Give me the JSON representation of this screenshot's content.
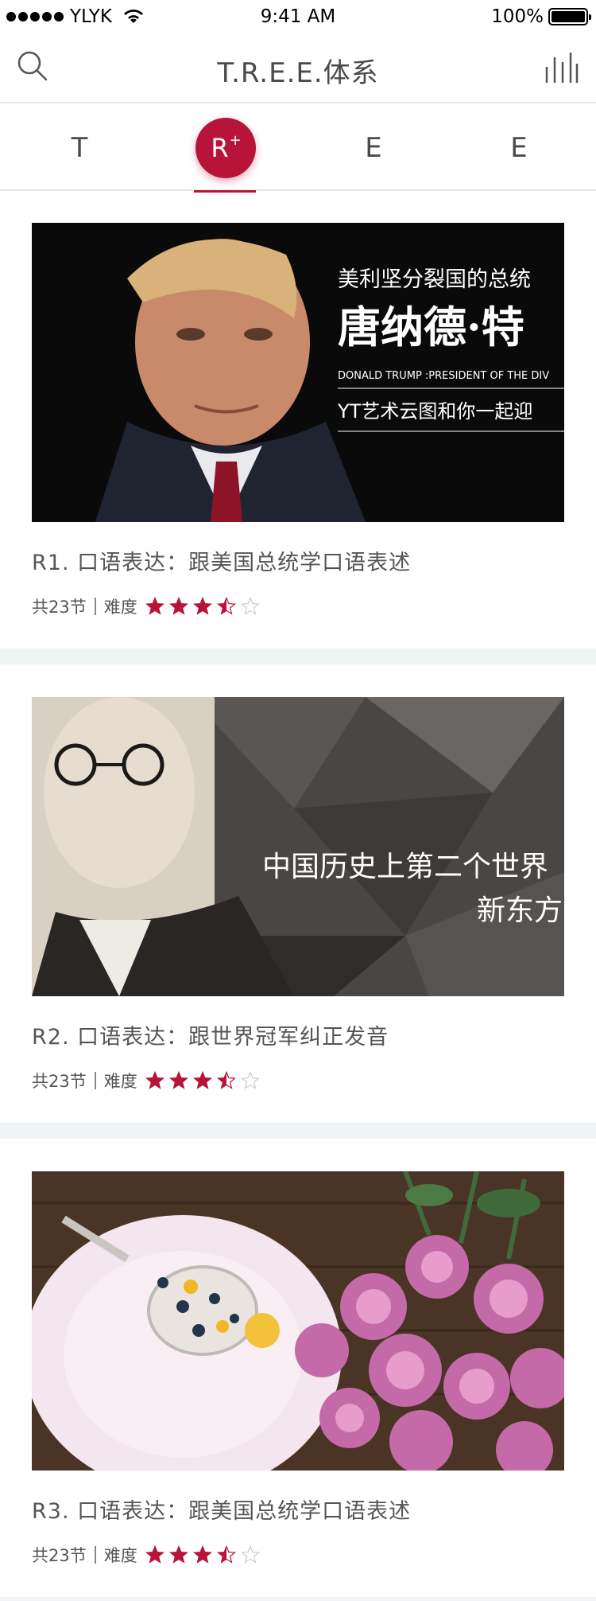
{
  "status_bar": {
    "carrier": "YLYK",
    "time": "9:41 AM",
    "battery": "100%",
    "battery_level": 1.0
  },
  "nav": {
    "title": "T.R.E.E.体系",
    "left_icon": "search-icon",
    "right_icon": "bar-chart-icon"
  },
  "tabs": [
    {
      "label": "T",
      "active": false
    },
    {
      "label": "R",
      "sup": "+",
      "active": true
    },
    {
      "label": "E",
      "active": false
    },
    {
      "label": "E",
      "active": false
    }
  ],
  "colors": {
    "accent": "#b8143a",
    "divider": "#eef5f4",
    "star_empty": "#cccccc"
  },
  "courses": [
    {
      "title": "R1. 口语表达：跟美国总统学口语表述",
      "lessons": "共23节",
      "difficulty_label": "难度",
      "rating": 3.5,
      "rating_max": 5,
      "image_text": {
        "line1": "美利坚分裂国的总统",
        "line2": "唐纳德·特",
        "line3": "DONALD TRUMP :PRESIDENT OF THE DIV",
        "line4": "YT艺术云图和你一起迎"
      }
    },
    {
      "title": "R2. 口语表达：跟世界冠军纠正发音",
      "lessons": "共23节",
      "difficulty_label": "难度",
      "rating": 3.5,
      "rating_max": 5,
      "image_text": {
        "line1": "中国历史上第二个世界",
        "line2": "新东方"
      }
    },
    {
      "title": "R3. 口语表达：跟美国总统学口语表述",
      "lessons": "共23节",
      "difficulty_label": "难度",
      "rating": 3.5,
      "rating_max": 5
    }
  ]
}
